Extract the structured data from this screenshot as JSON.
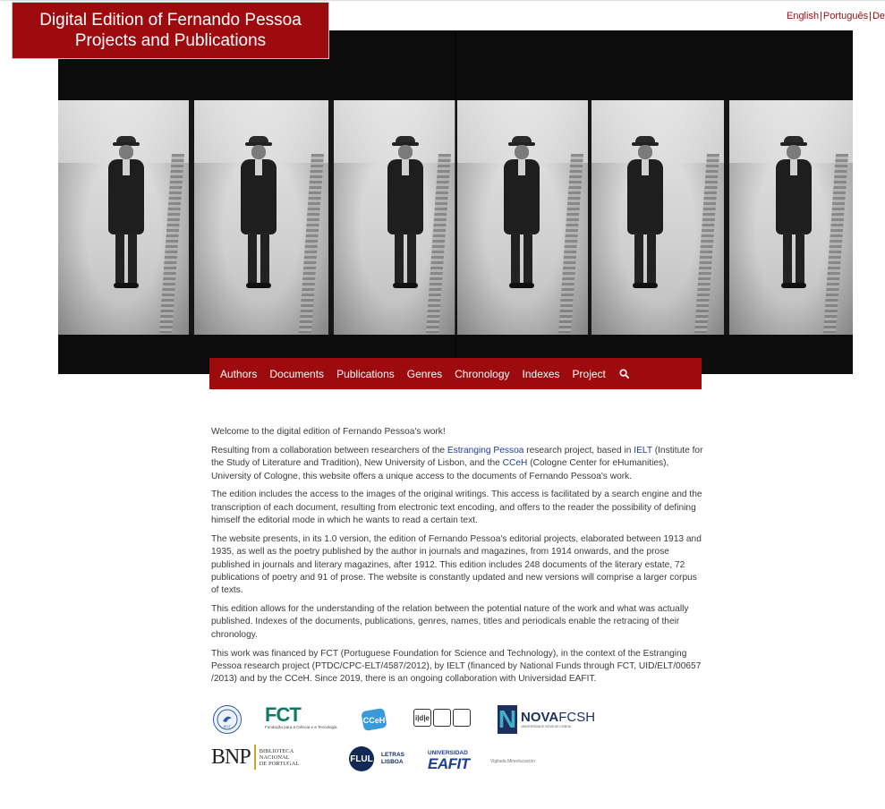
{
  "header": {
    "title_line1": "Digital Edition of Fernando Pessoa",
    "title_line2": "Projects and Publications"
  },
  "languages": [
    "English",
    "Português",
    "De"
  ],
  "nav": {
    "items": [
      "Authors",
      "Documents",
      "Publications",
      "Genres",
      "Chronology",
      "Indexes",
      "Project"
    ],
    "search_icon": "search-icon"
  },
  "content": {
    "welcome": "Welcome to the digital edition of Fernando Pessoa's work!",
    "p2": {
      "t1": "Resulting from a collaboration between researchers of the ",
      "link1": "Estranging Pessoa",
      "t2": " research project, based in ",
      "link2": "IELT",
      "t3": " (Institute for the Study of Literature and Tradition), New University of Lisbon, and the ",
      "link3": "CCeH",
      "t4": " (Cologne Center for eHumanities), University of Cologne, this website offers a unique access to the documents of Fernando Pessoa's work."
    },
    "p3": "The edition includes the access to the images of the original writings. This access is facilitated by a search engine and the transcription of each document, resulting from electronic text encoding, and offers to the reader the possibility of defining himself the editorial mode in which he wants to read a certain text.",
    "p4": "The website presents, in its 1.0 version, the edition of Fernando Pessoa's editorial projects, elaborated between 1913 and 1935, as well as the poetry published by the author in journals and magazines, from 1914 onwards, and the prose published in journals and literary magazines, after 1912. This edition includes 248 documents of the literary estate, 72 publications of poetry and 91 of prose. The website is constantly updated and new versions will comprise a larger corpus of texts.",
    "p5": "This edition allows for the understanding of the relation between the potential nature of the work and what was actually published. Indexes of the documents, publications, genres, names, titles and periodicals enable the retracing of their chronology.",
    "p6": "This work was financed by FCT (Portuguese Foundation for Science and Technology), in the context of the Estranging Pessoa research project (PTDC/CPC-ELT/4587/2012), by IELT (financed by National Funds through FCT, UID/ELT/00657 /2013) and by the CCeH. Since 2019, there is an ongoing collaboration with Universidad EAFIT."
  },
  "logos": {
    "ielt": "IELT",
    "fct_big": "FCT",
    "fct_small": "Fundação para a Ciência e a Tecnologia",
    "cceh": "CCeH",
    "idje": [
      "i|d|e",
      "",
      ""
    ],
    "nova_letter": "N",
    "nova_main_bold": "NOVA",
    "nova_main_light": "FCSH",
    "nova_sub": "UNIVERSIDADE NOVA DE LISBOA",
    "bnp_mark": "BNP",
    "bnp_text": [
      "BIBLIOTECA",
      "NACIONAL",
      "DE PORTUGAL"
    ],
    "flul_circle": "FLUL",
    "flul_text": [
      "LETRAS",
      "LISBOA"
    ],
    "eafit_small": "UNIVERSIDAD",
    "eafit_big": "EAFIT",
    "vigilada": "Vigilada Mineducación"
  },
  "colors": {
    "brand_red": "#9e0b0f",
    "link_blue": "#1f3f97"
  }
}
